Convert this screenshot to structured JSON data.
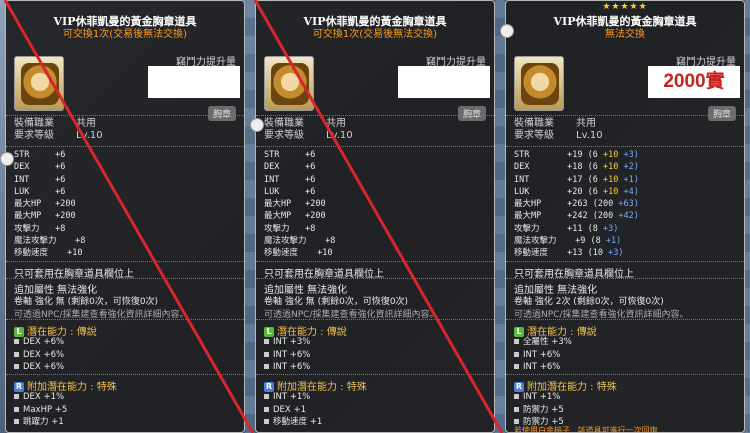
{
  "cards": [
    {
      "stars": "",
      "title": "VIP休菲凱曼的黃金胸章道具",
      "trade": "可交換1次(交易後無法交換)",
      "attack_label": "竊鬥力提升量",
      "price": "",
      "chest": "胸章",
      "req_job_label": "裝備職業",
      "req_job": "共用",
      "req_lv_label": "要求等級",
      "req_lv": "Lv.10",
      "stats": [
        [
          "STR",
          "+6"
        ],
        [
          "DEX",
          "+6"
        ],
        [
          "INT",
          "+6"
        ],
        [
          "LUK",
          "+6"
        ],
        [
          "最大HP",
          "+200"
        ],
        [
          "最大MP",
          "+200"
        ],
        [
          "攻擊力",
          "+8"
        ],
        [
          "魔法攻擊力",
          "+8"
        ],
        [
          "移動速度",
          "+10"
        ]
      ],
      "only": "只可套用在胸章道具欄位上",
      "attr": "追加屬性  無法強化",
      "scroll": "卷軸 強化 無 (剩餘0次，可恢復0次)",
      "npc": "可透過NPC/採集建查看強化資訊詳細內容。",
      "pot_title": "潛在能力 : 傳說",
      "pot": [
        "DEX +6%",
        "DEX +6%",
        "DEX +6%"
      ],
      "add_title": "附加潛在能力 : 特殊",
      "add": [
        "DEX +1%",
        "MaxHP +5",
        "跳躍力 +1"
      ]
    },
    {
      "stars": "",
      "title": "VIP休菲凱曼的黃金胸章道具",
      "trade": "可交換1次(交易後無法交換)",
      "attack_label": "竊鬥力提升量",
      "price": "",
      "chest": "胸章",
      "req_job_label": "裝備職業",
      "req_job": "共用",
      "req_lv_label": "要求等級",
      "req_lv": "Lv.10",
      "stats": [
        [
          "STR",
          "+6"
        ],
        [
          "DEX",
          "+6"
        ],
        [
          "INT",
          "+6"
        ],
        [
          "LUK",
          "+6"
        ],
        [
          "最大HP",
          "+200"
        ],
        [
          "最大MP",
          "+200"
        ],
        [
          "攻擊力",
          "+8"
        ],
        [
          "魔法攻擊力",
          "+8"
        ],
        [
          "移動速度",
          "+10"
        ]
      ],
      "only": "只可套用在胸章道具欄位上",
      "attr": "追加屬性  無法強化",
      "scroll": "卷軸 強化 無 (剩餘0次，可恢復0次)",
      "npc": "可透過NPC/採集建查看強化資訊詳細內容。",
      "pot_title": "潛在能力 : 傳說",
      "pot": [
        "INT +3%",
        "INT +6%",
        "INT +6%"
      ],
      "add_title": "附加潛在能力 : 特殊",
      "add": [
        "INT +1%",
        "DEX +1",
        "移動速度 +1"
      ]
    },
    {
      "stars": "★★★★★",
      "title": "VIP休菲凱曼的黃金胸章道具",
      "trade": "無法交換",
      "attack_label": "竊鬥力提升量",
      "price": "2000實",
      "chest": "胸章",
      "req_job_label": "裝備職業",
      "req_job": "共用",
      "req_lv_label": "要求等級",
      "req_lv": "Lv.10",
      "stats3": [
        {
          "n": "STR",
          "v": "+19",
          "a": "(6",
          "y": "+10",
          "b": "+3)"
        },
        {
          "n": "DEX",
          "v": "+18",
          "a": "(6",
          "y": "+10",
          "b": "+2)"
        },
        {
          "n": "INT",
          "v": "+17",
          "a": "(6",
          "y": "+10",
          "b": "+1)"
        },
        {
          "n": "LUK",
          "v": "+20",
          "a": "(6",
          "y": "+10",
          "b": "+4)"
        },
        {
          "n": "最大HP",
          "v": "+263",
          "a": "(200",
          "y": "",
          "b": "+63)"
        },
        {
          "n": "最大MP",
          "v": "+242",
          "a": "(200",
          "y": "",
          "b": "+42)"
        },
        {
          "n": "攻擊力",
          "v": "+11",
          "a": "(8",
          "y": "",
          "b": "+3)"
        },
        {
          "n": "魔法攻擊力",
          "v": "+9",
          "a": "(8",
          "y": "",
          "b": "+1)"
        },
        {
          "n": "移動速度",
          "v": "+13",
          "a": "(10",
          "y": "",
          "b": "+3)"
        }
      ],
      "only": "只可套用在胸章道具欄位上",
      "attr": "追加屬性  無法強化",
      "scroll": "卷軸 強化 2次 (剩餘0次，可恢復0次)",
      "npc": "可透過NPC/採集建查看強化資訊詳細內容。",
      "pot_title": "潛在能力 : 傳說",
      "pot": [
        "全屬性 +3%",
        "INT +6%",
        "INT +6%"
      ],
      "add_title": "附加潛在能力 : 特殊",
      "add": [
        "INT +1%",
        "防禦力 +5",
        "防禦力 +5"
      ],
      "footer": "若使用白金槌子...該道具可進行一次回復"
    }
  ],
  "colors": {
    "accent": "#ff9b1a",
    "line": "#d8262a",
    "price": "#c8231d"
  }
}
